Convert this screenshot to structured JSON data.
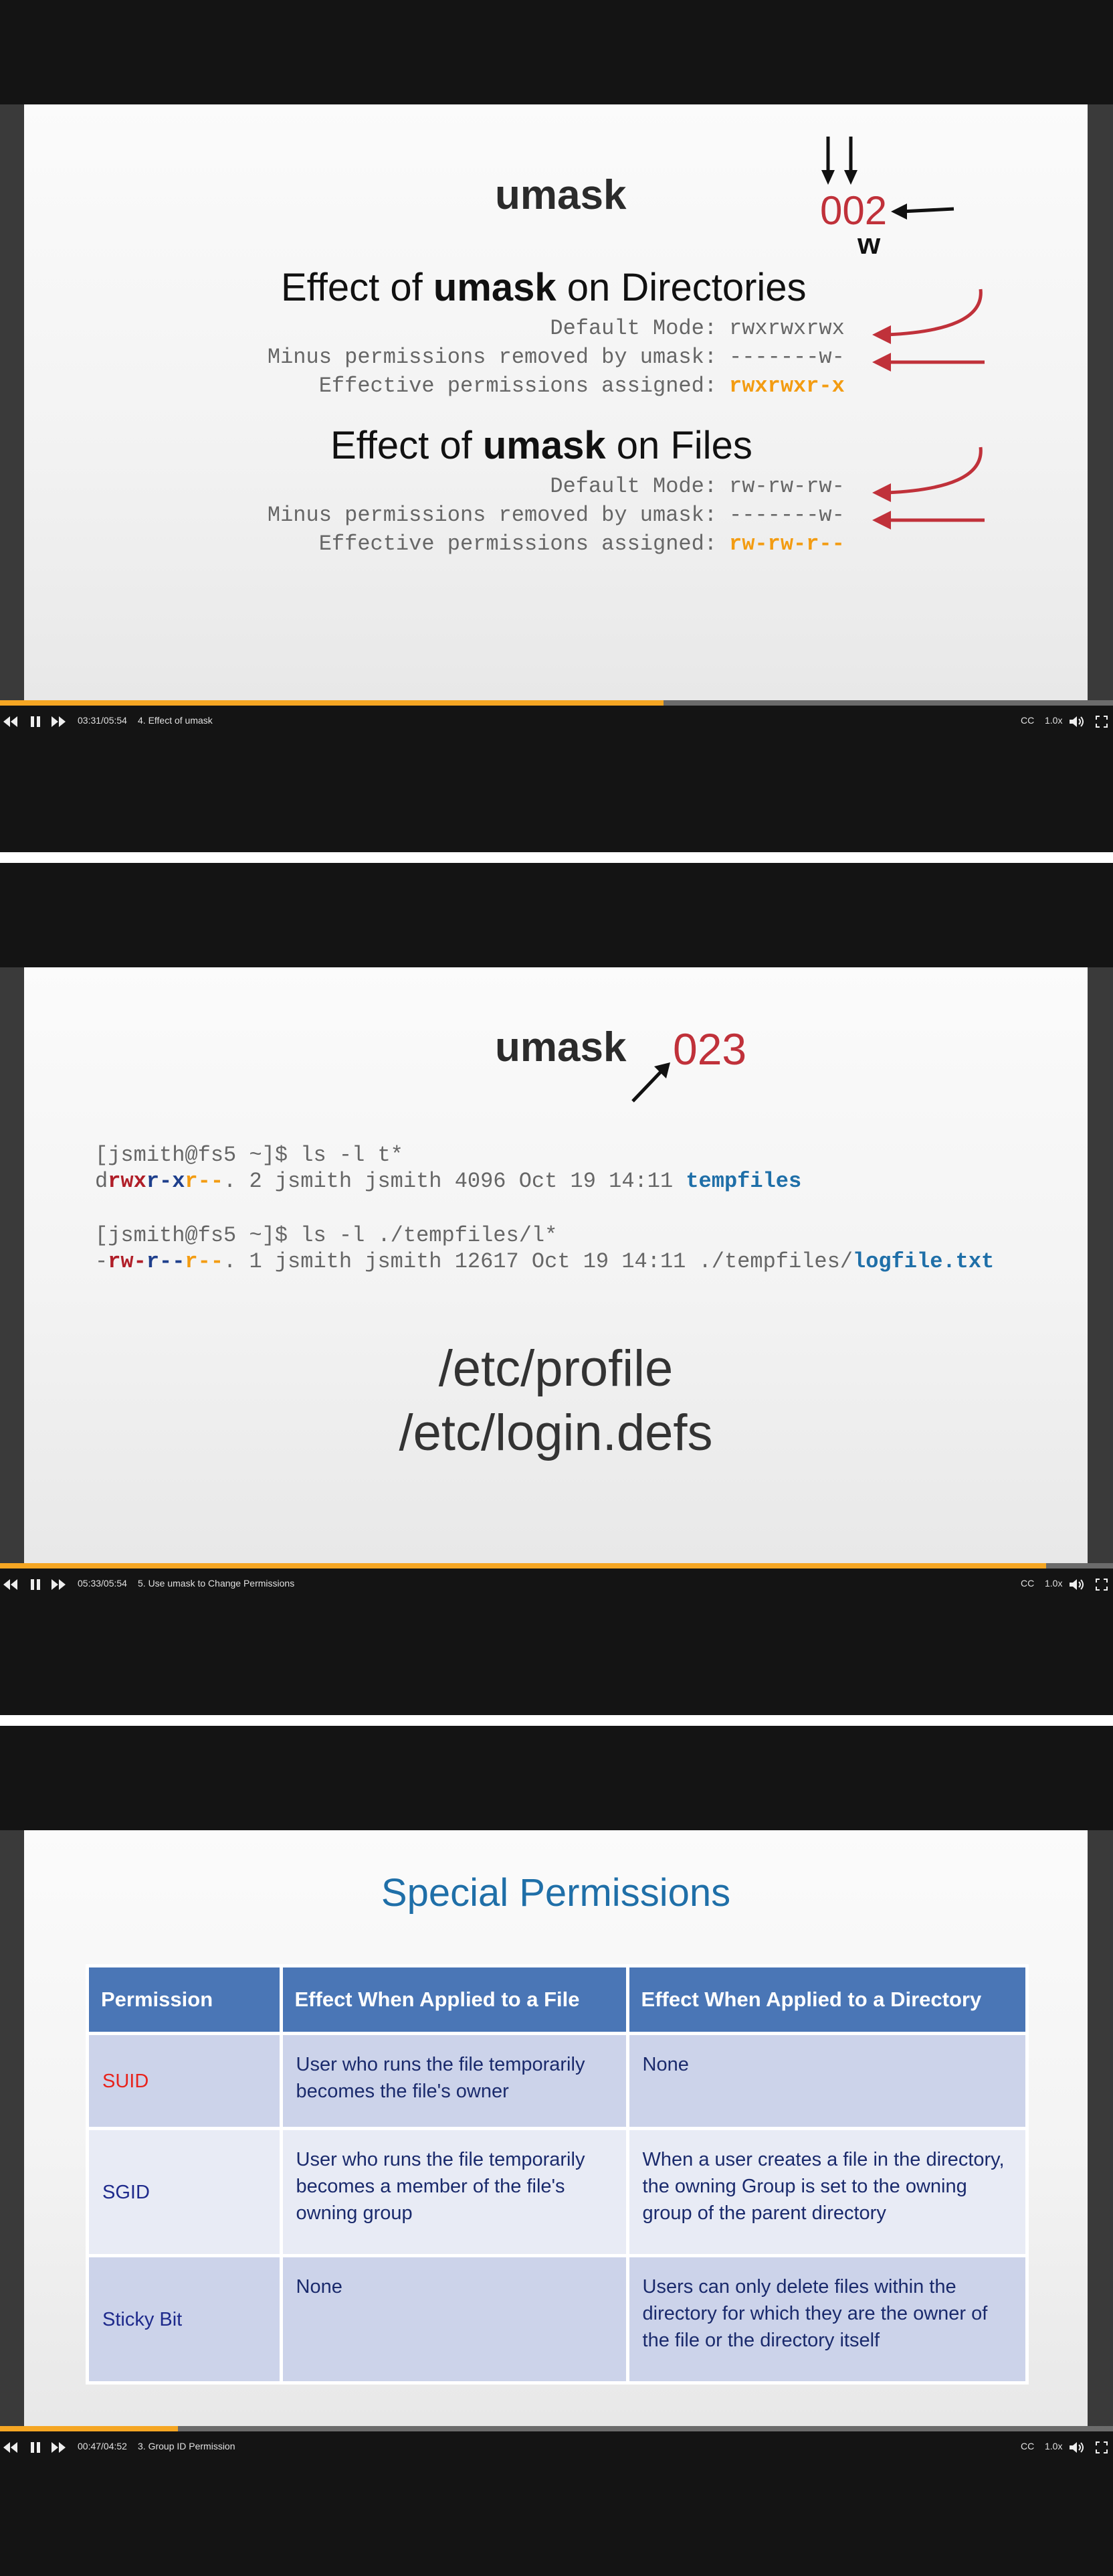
{
  "panels": [
    {
      "slide": {
        "title": "umask",
        "value": "002",
        "w_label": "w",
        "dirs": {
          "heading_pre": "Effect of ",
          "heading_bold": "umask",
          "heading_post": " on Directories",
          "rows": [
            {
              "label": "Default Mode:",
              "value": "rwxrwxrwx"
            },
            {
              "label": "Minus permissions removed by umask:",
              "value": "-------w-"
            },
            {
              "label": "Effective permissions assigned:",
              "value": "rwxrwxr-x"
            }
          ]
        },
        "files": {
          "heading_pre": "Effect of ",
          "heading_bold": "umask",
          "heading_post": " on Files",
          "rows": [
            {
              "label": "Default Mode:",
              "value": "rw-rw-rw-"
            },
            {
              "label": "Minus permissions removed by umask:",
              "value": "-------w-"
            },
            {
              "label": "Effective permissions assigned:",
              "value": "rw-rw-r--"
            }
          ]
        }
      },
      "player": {
        "time": "03:31/05:54",
        "lecture": "4. Effect of umask",
        "progress": 0.596,
        "speed": "1.0x",
        "cc": "CC"
      }
    },
    {
      "slide": {
        "title": "umask",
        "value": "023",
        "cmd1_prompt": "[jsmith@fs5 ~]$ ls -l t*",
        "cmd1_out": {
          "d": "d",
          "u": "rwx",
          "g1": "r-x",
          "g2": "r",
          "o": "--",
          "rest": ". 2 jsmith jsmith 4096 Oct 19 14:11 ",
          "name": "tempfiles"
        },
        "cmd2_prompt": "[jsmith@fs5 ~]$ ls -l ./tempfiles/l*",
        "cmd2_out": {
          "d": "-",
          "u": "rw-",
          "g1": "r--",
          "g2": "r",
          "o": "--",
          "rest": ". 1 jsmith jsmith 12617 Oct 19 14:11 ./tempfiles/",
          "name": "logfile.txt"
        },
        "path1": "/etc/profile",
        "path2": "/etc/login.defs"
      },
      "player": {
        "time": "05:33/05:54",
        "lecture": "5. Use umask to Change Permissions",
        "progress": 0.94,
        "speed": "1.0x",
        "cc": "CC"
      }
    },
    {
      "slide": {
        "title": "Special Permissions",
        "headers": [
          "Permission",
          "Effect When Applied to a File",
          "Effect When Applied to a Directory"
        ],
        "rows": [
          {
            "name": "SUID",
            "file": "User who runs the file temporarily becomes the file's owner",
            "dir": "None",
            "color": "#e8231c"
          },
          {
            "name": "SGID",
            "file": "User who runs the file temporarily becomes a member of the file's owning group",
            "dir": "When a user creates a file in the directory, the owning Group is set to the owning group of the parent directory",
            "color": "#1e2a8c"
          },
          {
            "name": "Sticky Bit",
            "file": "None",
            "dir": "Users can only delete files within the directory for which they are the owner of the file or the directory itself",
            "color": "#1e2a8c"
          }
        ]
      },
      "player": {
        "time": "00:47/04:52",
        "lecture": "3. Group ID Permission",
        "progress": 0.16,
        "speed": "1.0x",
        "cc": "CC"
      }
    }
  ]
}
